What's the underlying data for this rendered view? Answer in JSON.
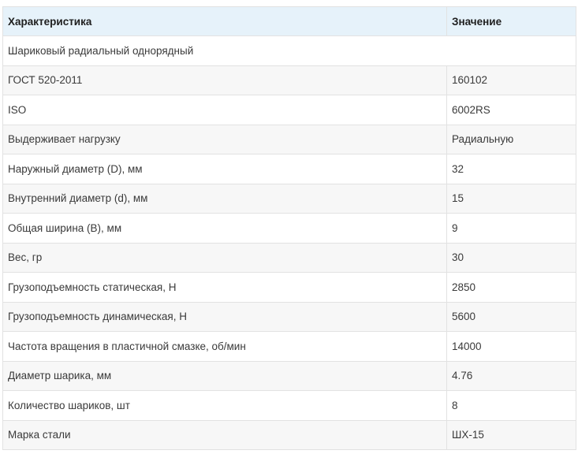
{
  "table": {
    "headers": {
      "characteristic": "Характеристика",
      "value": "Значение"
    },
    "title_row": "Шариковый радиальный однорядный",
    "rows": [
      {
        "label": "ГОСТ 520-2011",
        "value": "160102"
      },
      {
        "label": "ISO",
        "value": "6002RS"
      },
      {
        "label": "Выдерживает нагрузку",
        "value": "Радиальную"
      },
      {
        "label": "Наружный диаметр (D), мм",
        "value": "32"
      },
      {
        "label": "Внутренний диаметр (d), мм",
        "value": "15"
      },
      {
        "label": "Общая ширина (B), мм",
        "value": "9"
      },
      {
        "label": "Вес, гр",
        "value": "30"
      },
      {
        "label": "Грузоподъемность статическая, Н",
        "value": "2850"
      },
      {
        "label": "Грузоподъемность динамическая, Н",
        "value": "5600"
      },
      {
        "label": "Частота вращения в пластичной смазке, об/мин",
        "value": "14000"
      },
      {
        "label": "Диаметр шарика, мм",
        "value": "4.76"
      },
      {
        "label": "Количество шариков, шт",
        "value": "8"
      },
      {
        "label": "Марка стали",
        "value": "ШХ-15"
      }
    ]
  }
}
